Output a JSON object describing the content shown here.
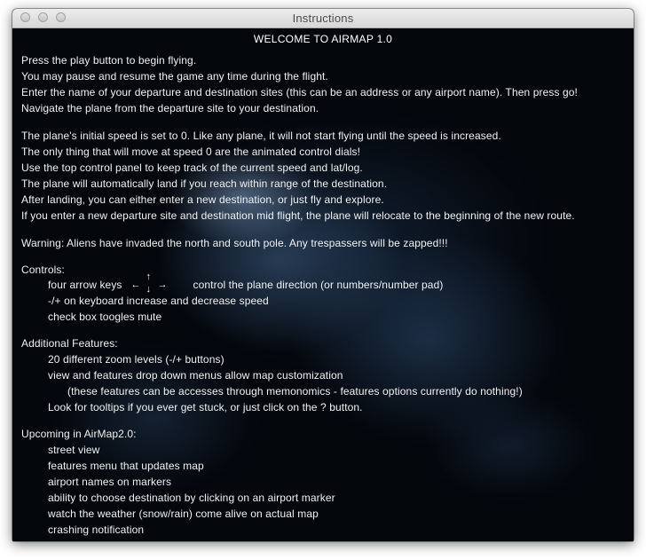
{
  "window": {
    "title": "Instructions"
  },
  "heading": "WELCOME TO AIRMAP 1.0",
  "intro": [
    "Press the play button to begin flying.",
    "You may pause and resume the game any time during the flight.",
    "Enter the name of your departure and destination sites (this can be an address or any airport name). Then press go!",
    "Navigate the plane from the departure site to your destination."
  ],
  "speed": [
    "The plane's initial speed is set to 0. Like any plane, it will not start flying until the speed is increased.",
    "The only thing that will move at speed 0 are the animated control dials!",
    "Use the top control panel to keep track of the current speed and lat/log.",
    "The plane will automatically land if you reach within range of the destination.",
    "After landing, you can either enter a new destination, or just fly and explore.",
    "If you enter a new departure site and destination mid flight, the plane will relocate to the beginning of the new route."
  ],
  "warning": "Warning: Aliens have invaded the north and south pole. Any trespassers will be zapped!!!",
  "controls": {
    "title": "Controls:",
    "arrow_keys_label": "four arrow keys",
    "arrow_keys_desc": "control the plane direction (or numbers/number pad)",
    "speed_keys": "-/+ on keyboard increase and decrease speed",
    "mute": "check box toogles mute"
  },
  "features": {
    "title": "Additional Features:",
    "zoom": "20 different zoom levels (-/+ buttons)",
    "menus": "view and features drop down menus allow map customization",
    "menus_note": "(these features can be accesses through memonomics - features options currently do nothing!)",
    "tooltips": "Look for tooltips if you ever get stuck, or just click on the ? button."
  },
  "upcoming": {
    "title": "Upcoming in AirMap2.0:",
    "items": [
      "street view",
      "features menu that updates map",
      "airport names on markers",
      "ability to choose destination by clicking on an airport marker",
      "watch the weather (snow/rain) come alive on actual map",
      "crashing notification"
    ]
  },
  "arrows": {
    "left": "←",
    "up": "↑",
    "down": "↓",
    "right": "→"
  }
}
